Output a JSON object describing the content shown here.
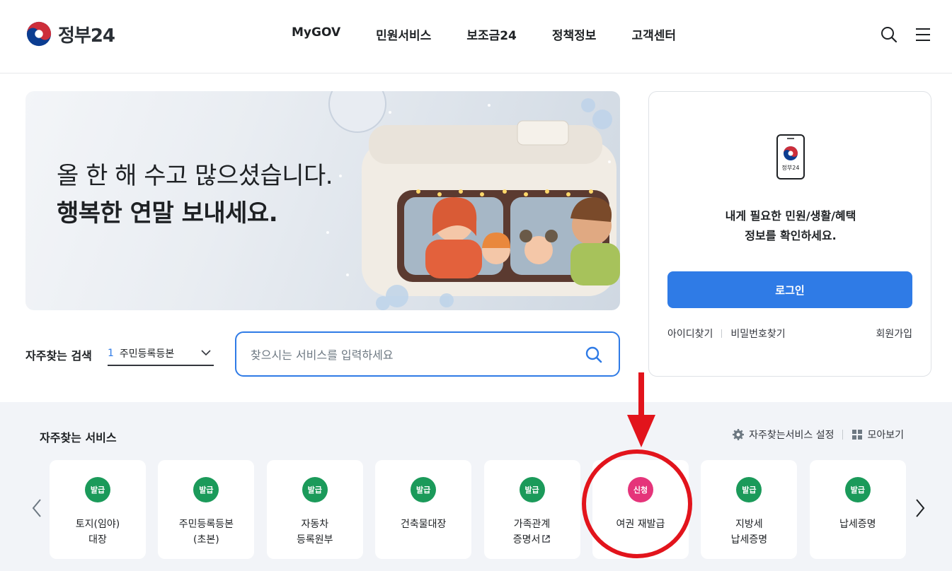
{
  "header": {
    "logo_text": "정부24",
    "nav": [
      "MyGOV",
      "민원서비스",
      "보조금24",
      "정책정보",
      "고객센터"
    ],
    "icons": [
      "search-icon",
      "menu-icon"
    ]
  },
  "banner": {
    "line1": "올 한 해 수고 많으셨습니다.",
    "line2": "행복한 연말 보내세요."
  },
  "login": {
    "phone_label": "정부24",
    "message_line1": "내게 필요한 민원/생활/혜택",
    "message_line2": "정보를 확인하세요.",
    "login_button": "로그인",
    "find_id": "아이디찾기",
    "find_pw": "비밀번호찾기",
    "join": "회원가입"
  },
  "search": {
    "freq_label": "자주찾는 검색",
    "freq_num": "1",
    "freq_value": "주민등록등본",
    "placeholder": "찾으시는 서비스를 입력하세요"
  },
  "services": {
    "title": "자주찾는 서비스",
    "settings": "자주찾는서비스 설정",
    "view_all": "모아보기",
    "items": [
      {
        "badge": "발급",
        "line1": "토지(임야)",
        "line2": "대장",
        "color": "#1b9a5a"
      },
      {
        "badge": "발급",
        "line1": "주민등록등본",
        "line2": "(초본)",
        "color": "#1b9a5a"
      },
      {
        "badge": "발급",
        "line1": "자동차",
        "line2": "등록원부",
        "color": "#1b9a5a"
      },
      {
        "badge": "발급",
        "line1": "건축물대장",
        "line2": "",
        "color": "#1b9a5a"
      },
      {
        "badge": "발급",
        "line1": "가족관계",
        "line2": "증명서",
        "color": "#1b9a5a"
      },
      {
        "badge": "신청",
        "line1": "여권 재발급",
        "line2": "",
        "color": "#e5347a"
      },
      {
        "badge": "발급",
        "line1": "지방세",
        "line2": "납세증명",
        "color": "#1b9a5a"
      },
      {
        "badge": "발급",
        "line1": "납세증명",
        "line2": "",
        "color": "#1b9a5a"
      }
    ]
  },
  "colors": {
    "primary": "#2f7be6",
    "annotation": "#e2141c"
  }
}
